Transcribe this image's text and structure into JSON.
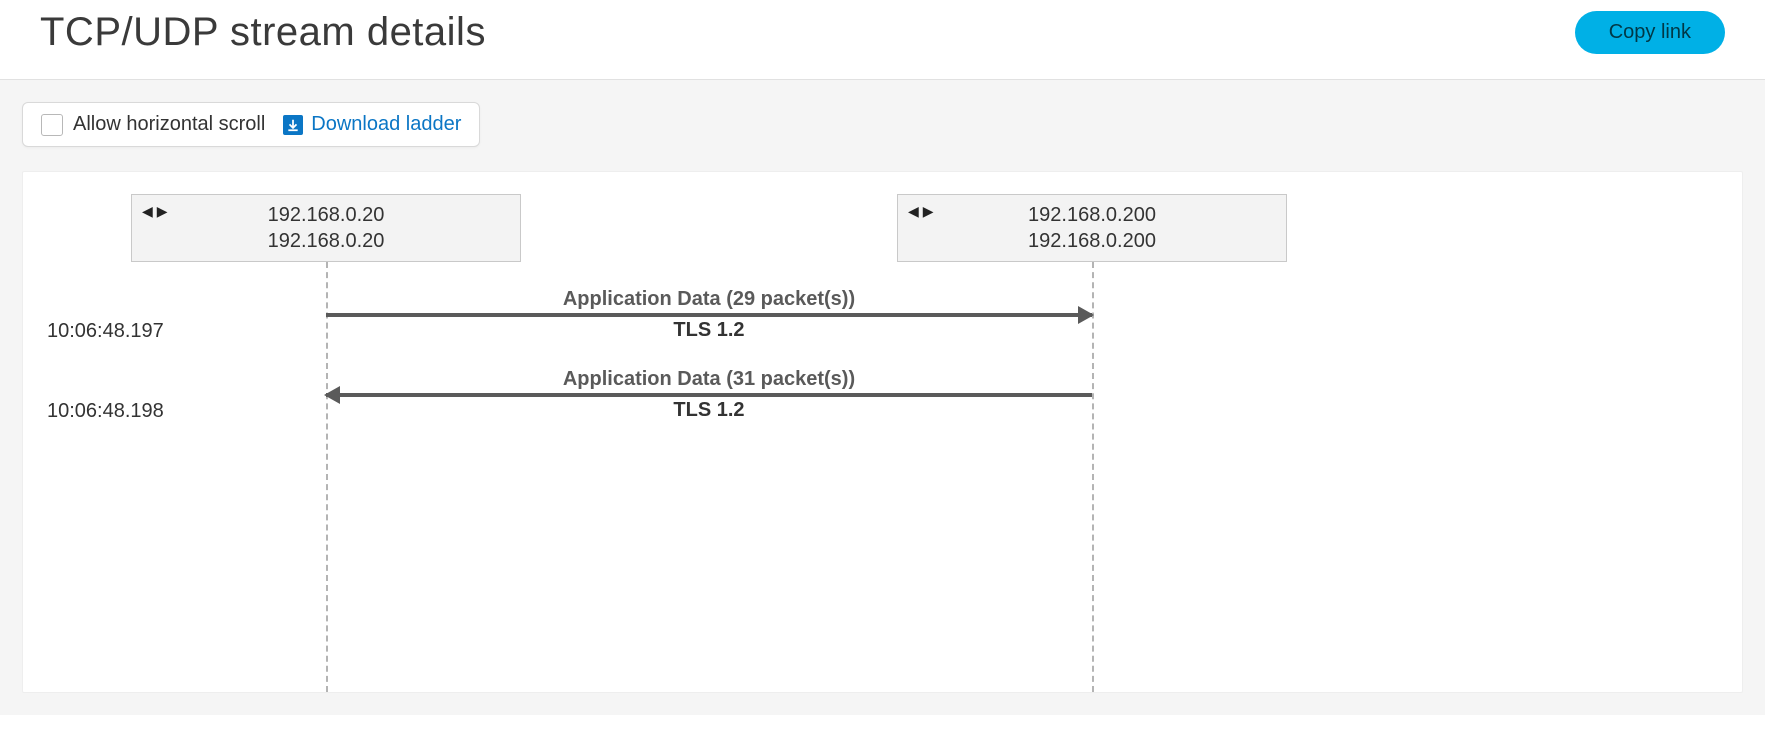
{
  "header": {
    "title": "TCP/UDP stream details",
    "copy_link": "Copy link"
  },
  "toolbar": {
    "allow_scroll_label": "Allow horizontal scroll",
    "download_label": "Download ladder"
  },
  "hosts": {
    "left": {
      "line1": "192.168.0.20",
      "line2": "192.168.0.20"
    },
    "right": {
      "line1": "192.168.0.200",
      "line2": "192.168.0.200"
    }
  },
  "messages": [
    {
      "timestamp": "10:06:48.197",
      "top": "Application Data (29 packet(s))",
      "bottom": "TLS 1.2",
      "direction": "right"
    },
    {
      "timestamp": "10:06:48.198",
      "top": "Application Data (31 packet(s))",
      "bottom": "TLS 1.2",
      "direction": "left"
    }
  ]
}
